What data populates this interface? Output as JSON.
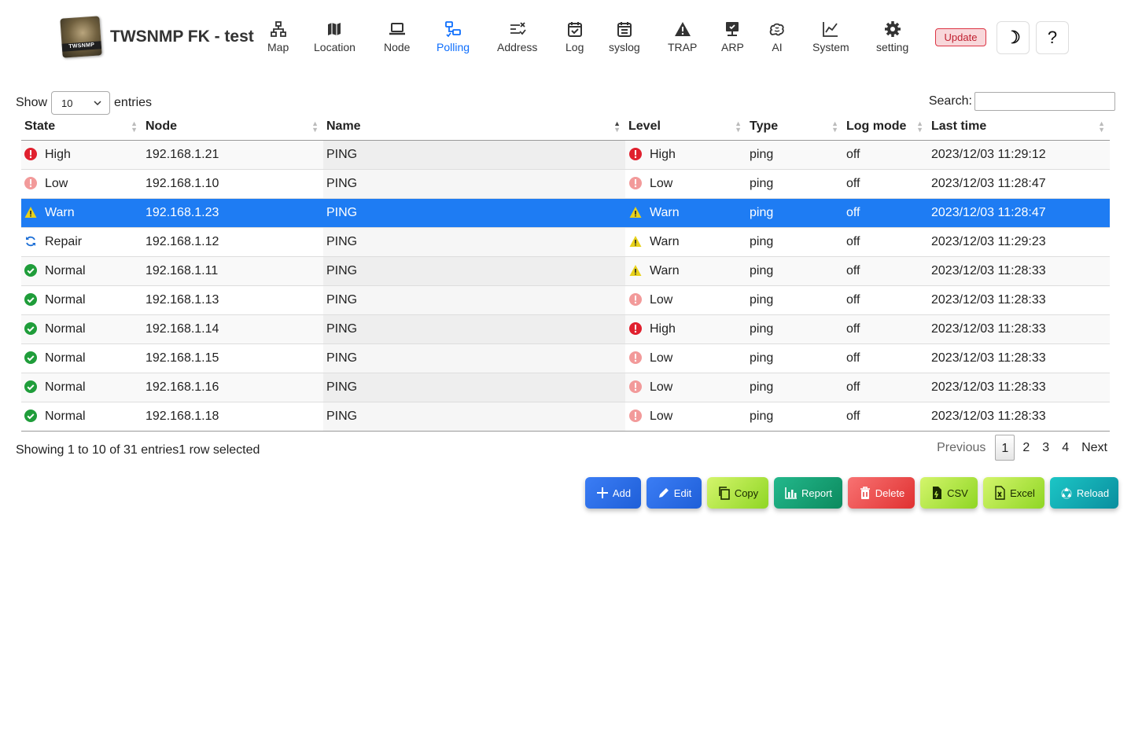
{
  "app": {
    "title": "TWSNMP FK - test",
    "logo_text": "TWSNMP"
  },
  "nav": [
    {
      "label": "Map",
      "icon": "network-icon"
    },
    {
      "label": "Location",
      "icon": "map-icon"
    },
    {
      "label": "Node",
      "icon": "laptop-icon"
    },
    {
      "label": "Polling",
      "icon": "polling-icon",
      "active": true
    },
    {
      "label": "Address",
      "icon": "address-icon"
    },
    {
      "label": "Log",
      "icon": "calendar-check-icon"
    },
    {
      "label": "syslog",
      "icon": "calendar-list-icon"
    },
    {
      "label": "TRAP",
      "icon": "warning-icon"
    },
    {
      "label": "ARP",
      "icon": "computer-icon"
    },
    {
      "label": "AI",
      "icon": "brain-icon"
    },
    {
      "label": "System",
      "icon": "line-chart-icon"
    },
    {
      "label": "setting",
      "icon": "gear-icon"
    }
  ],
  "header_buttons": {
    "update": "Update",
    "theme": "☽",
    "help": "?"
  },
  "table_controls": {
    "show": "Show",
    "page_length": "10",
    "entries": "entries",
    "search_label": "Search:",
    "search_value": ""
  },
  "table": {
    "columns": [
      "State",
      "Node",
      "Name",
      "Level",
      "Type",
      "Log mode",
      "Last time"
    ],
    "rows": [
      {
        "state": "High",
        "state_icon": "high",
        "node": "192.168.1.21",
        "name": "PING",
        "level": "High",
        "level_icon": "high",
        "type": "ping",
        "log_mode": "off",
        "last_time": "2023/12/03 11:29:12"
      },
      {
        "state": "Low",
        "state_icon": "low",
        "node": "192.168.1.10",
        "name": "PING",
        "level": "Low",
        "level_icon": "low",
        "type": "ping",
        "log_mode": "off",
        "last_time": "2023/12/03 11:28:47"
      },
      {
        "state": "Warn",
        "state_icon": "warn",
        "node": "192.168.1.23",
        "name": "PING",
        "level": "Warn",
        "level_icon": "warn",
        "type": "ping",
        "log_mode": "off",
        "last_time": "2023/12/03 11:28:47",
        "selected": true
      },
      {
        "state": "Repair",
        "state_icon": "repair",
        "node": "192.168.1.12",
        "name": "PING",
        "level": "Warn",
        "level_icon": "warn",
        "type": "ping",
        "log_mode": "off",
        "last_time": "2023/12/03 11:29:23"
      },
      {
        "state": "Normal",
        "state_icon": "normal",
        "node": "192.168.1.11",
        "name": "PING",
        "level": "Warn",
        "level_icon": "warn",
        "type": "ping",
        "log_mode": "off",
        "last_time": "2023/12/03 11:28:33"
      },
      {
        "state": "Normal",
        "state_icon": "normal",
        "node": "192.168.1.13",
        "name": "PING",
        "level": "Low",
        "level_icon": "low",
        "type": "ping",
        "log_mode": "off",
        "last_time": "2023/12/03 11:28:33"
      },
      {
        "state": "Normal",
        "state_icon": "normal",
        "node": "192.168.1.14",
        "name": "PING",
        "level": "High",
        "level_icon": "high",
        "type": "ping",
        "log_mode": "off",
        "last_time": "2023/12/03 11:28:33"
      },
      {
        "state": "Normal",
        "state_icon": "normal",
        "node": "192.168.1.15",
        "name": "PING",
        "level": "Low",
        "level_icon": "low",
        "type": "ping",
        "log_mode": "off",
        "last_time": "2023/12/03 11:28:33"
      },
      {
        "state": "Normal",
        "state_icon": "normal",
        "node": "192.168.1.16",
        "name": "PING",
        "level": "Low",
        "level_icon": "low",
        "type": "ping",
        "log_mode": "off",
        "last_time": "2023/12/03 11:28:33"
      },
      {
        "state": "Normal",
        "state_icon": "normal",
        "node": "192.168.1.18",
        "name": "PING",
        "level": "Low",
        "level_icon": "low",
        "type": "ping",
        "log_mode": "off",
        "last_time": "2023/12/03 11:28:33"
      }
    ]
  },
  "footer": {
    "info": "Showing 1 to 10 of 31 entries1 row selected",
    "previous": "Previous",
    "pages": [
      "1",
      "2",
      "3",
      "4"
    ],
    "current_page": "1",
    "next": "Next"
  },
  "actions": [
    {
      "label": "Add",
      "icon": "plus-icon",
      "colors": [
        "#3b7df5",
        "#1f5fd8"
      ],
      "text_color": "#ffffff"
    },
    {
      "label": "Edit",
      "icon": "pencil-icon",
      "colors": [
        "#3b7df5",
        "#1f5fd8"
      ],
      "text_color": "#ffffff"
    },
    {
      "label": "Copy",
      "icon": "copy-icon",
      "colors": [
        "#d4f56c",
        "#8fd624"
      ],
      "text_color": "#1a2a00"
    },
    {
      "label": "Report",
      "icon": "bar-chart-icon",
      "colors": [
        "#23b88c",
        "#0c8a5e"
      ],
      "text_color": "#ffffff"
    },
    {
      "label": "Delete",
      "icon": "trash-icon",
      "colors": [
        "#f87272",
        "#e03131"
      ],
      "text_color": "#ffffff"
    },
    {
      "label": "CSV",
      "icon": "csv-file-icon",
      "colors": [
        "#d4f56c",
        "#8fd624"
      ],
      "text_color": "#1a2a00"
    },
    {
      "label": "Excel",
      "icon": "excel-file-icon",
      "colors": [
        "#d4f56c",
        "#8fd624"
      ],
      "text_color": "#1a2a00"
    },
    {
      "label": "Reload",
      "icon": "recycle-icon",
      "colors": [
        "#1cc6c6",
        "#0a8e9e"
      ],
      "text_color": "#ffffff"
    }
  ],
  "status_colors": {
    "high": "#e0202e",
    "low": "#f29a9a",
    "warn": "#e8d11a",
    "normal": "#1f9d3a",
    "repair": "#1d6fd6",
    "active_nav": "#0d6efd",
    "selected_row": "#1e7cf3"
  }
}
